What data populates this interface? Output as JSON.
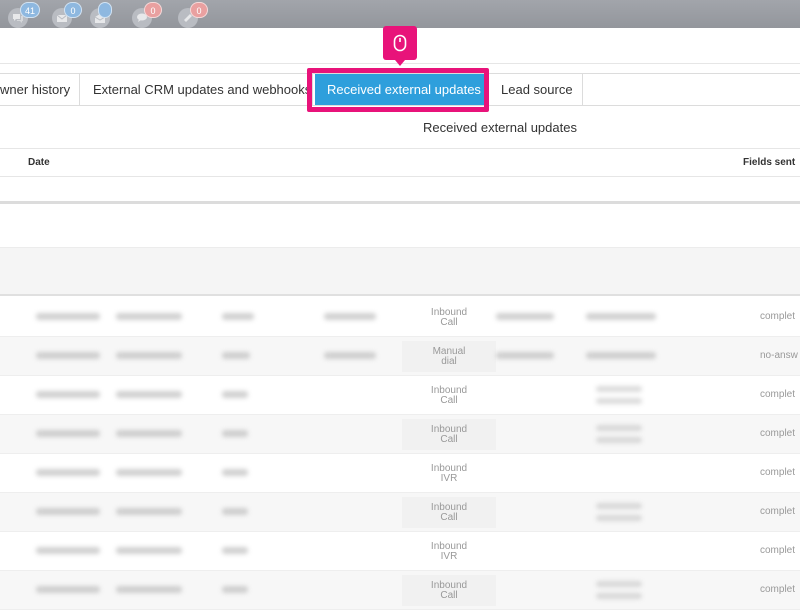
{
  "topbar": {
    "notifications": [
      {
        "icon": "chat-bubbles-icon",
        "count": "41",
        "color": "#8eb8e0"
      },
      {
        "icon": "envelope-icon",
        "count": "0",
        "color": "#8eb8e0"
      },
      {
        "icon": "open-mail-icon",
        "count": "",
        "color": "#8eb8e0"
      },
      {
        "icon": "speech-bubble-icon",
        "count": "0",
        "color": "#e9a0a0"
      },
      {
        "icon": "ticket-icon",
        "count": "0",
        "color": "#e9a0a0"
      }
    ]
  },
  "tabs": [
    {
      "label": "wner history",
      "active": false
    },
    {
      "label": "External CRM updates and webhooks",
      "active": false
    },
    {
      "label": "Received external updates",
      "active": true
    },
    {
      "label": "Lead source",
      "active": false
    }
  ],
  "accent_color": "#2e9fdc",
  "highlight_color": "#e8137a",
  "cursor_marker_icon": "mouse-icon",
  "section": {
    "title": "Received external updates",
    "columns": {
      "date": "Date",
      "fields_sent": "Fields sent"
    }
  },
  "calls": {
    "rows": [
      {
        "type_line1": "Inbound",
        "type_line2": "Call",
        "status": "complet"
      },
      {
        "type_line1": "Manual",
        "type_line2": "dial",
        "status": "no-answ"
      },
      {
        "type_line1": "Inbound",
        "type_line2": "Call",
        "status": "complet"
      },
      {
        "type_line1": "Inbound",
        "type_line2": "Call",
        "status": "complet"
      },
      {
        "type_line1": "Inbound",
        "type_line2": "IVR",
        "status": "complet"
      },
      {
        "type_line1": "Inbound",
        "type_line2": "Call",
        "status": "complet"
      },
      {
        "type_line1": "Inbound",
        "type_line2": "IVR",
        "status": "complet"
      },
      {
        "type_line1": "Inbound",
        "type_line2": "Call",
        "status": "complet"
      }
    ]
  }
}
